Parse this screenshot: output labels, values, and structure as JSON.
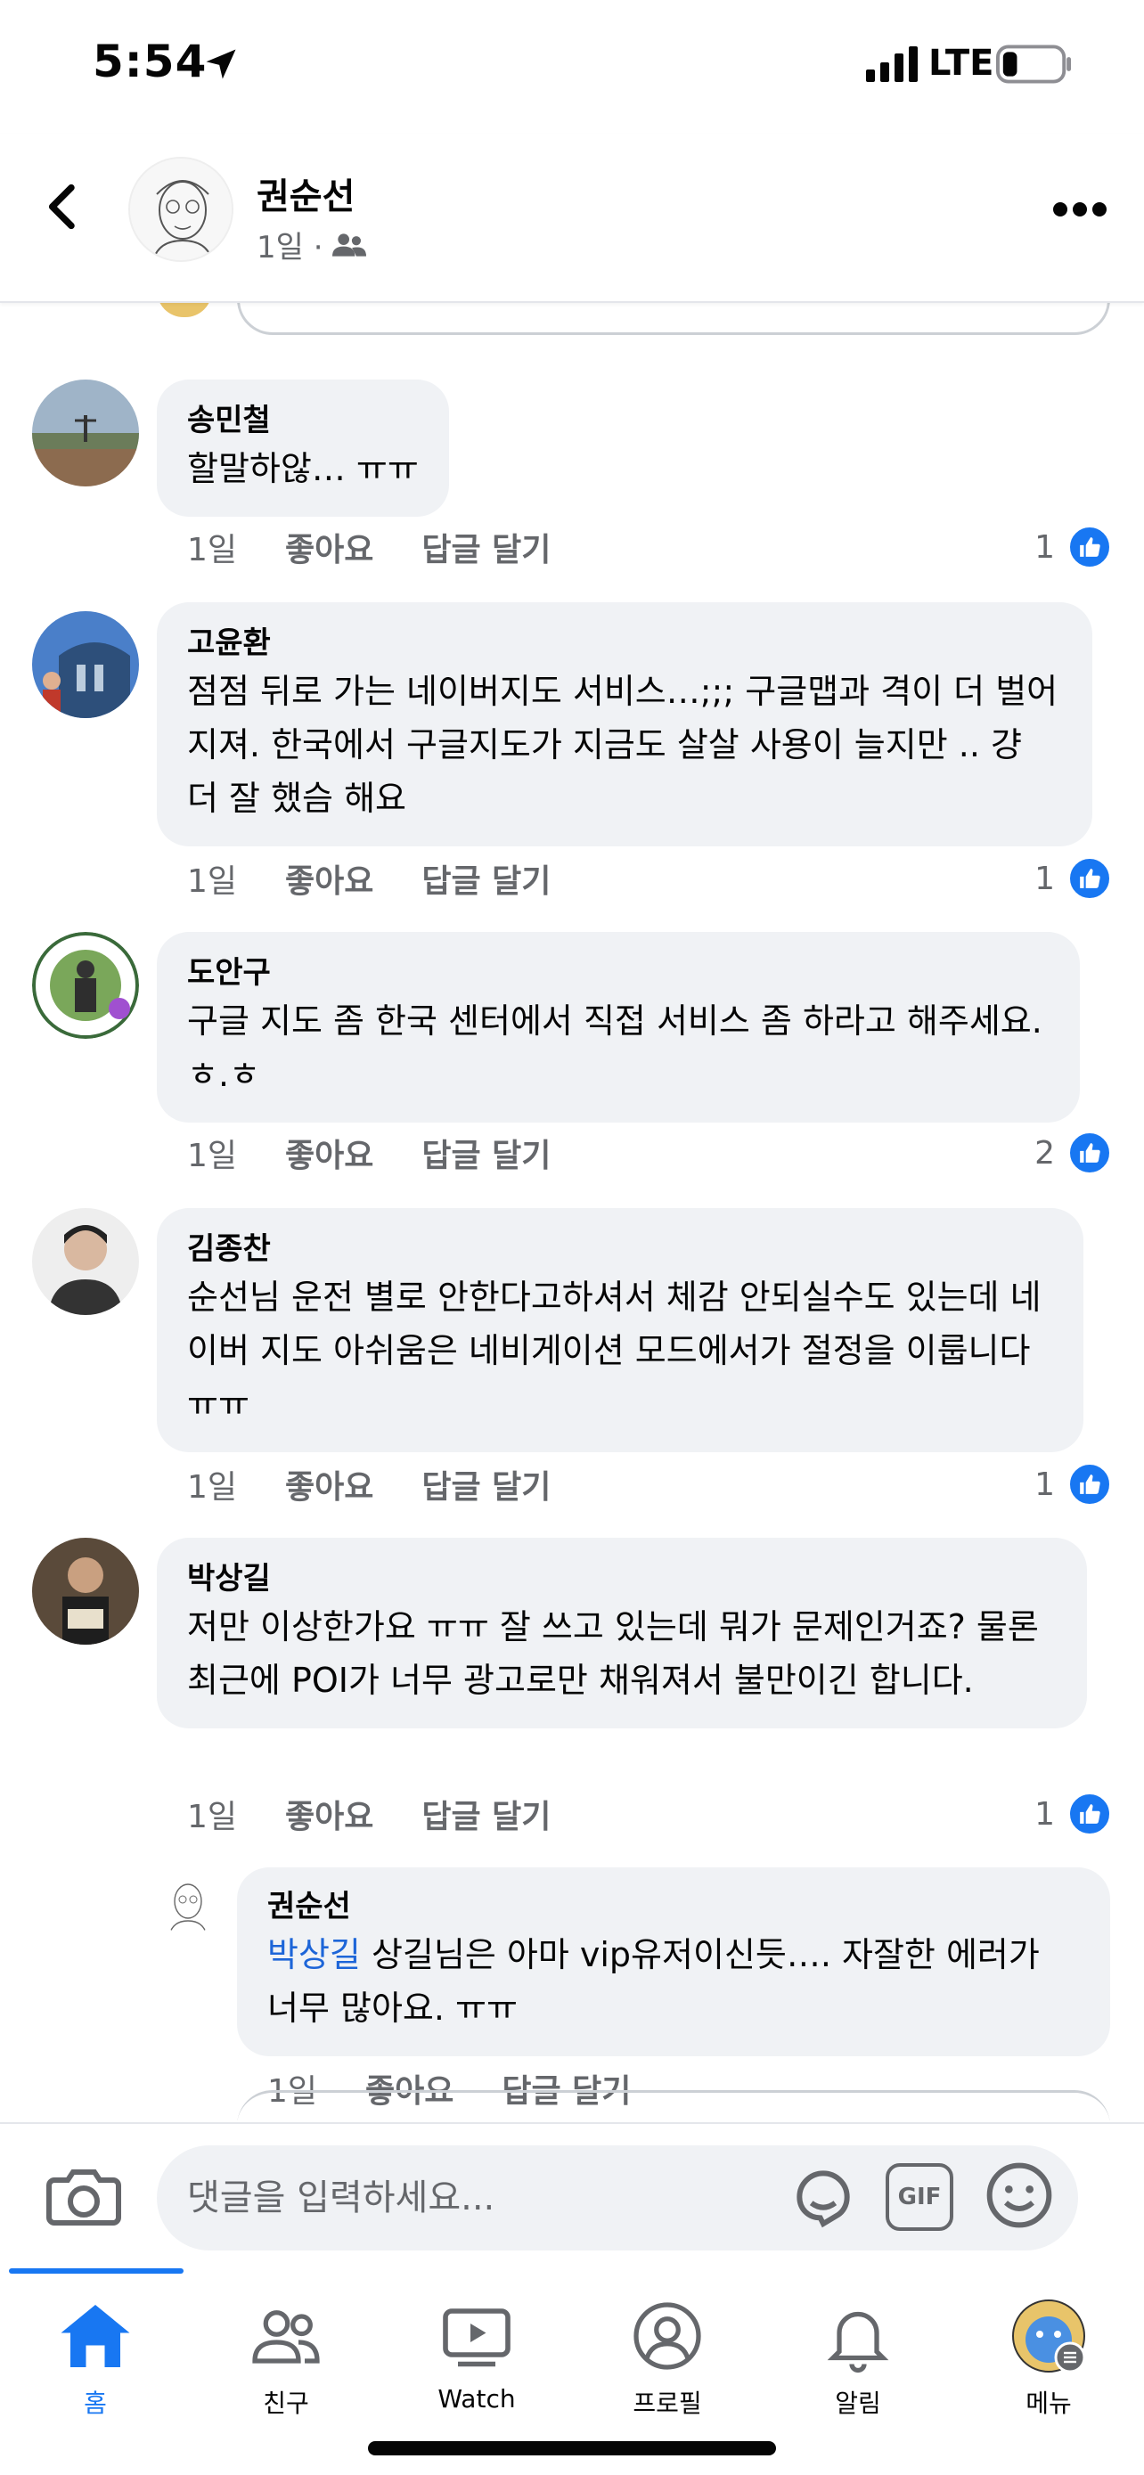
{
  "status_bar": {
    "time": "5:54",
    "network": "LTE"
  },
  "header": {
    "name": "권순선",
    "meta_time": "1일 ·"
  },
  "comments": [
    {
      "author": "송민철",
      "text": "할말하않… ㅠㅠ",
      "time": "1일",
      "like": "좋아요",
      "reply": "답글 달기",
      "likes": "1"
    },
    {
      "author": "고윤환",
      "text": "점점 뒤로 가는 네이버지도 서비스…;;; 구글맵과 격이 더 벌어지져. 한국에서 구글지도가 지금도 살살 사용이 늘지만 .. 걍 더 잘 했슴 해요",
      "time": "1일",
      "like": "좋아요",
      "reply": "답글 달기",
      "likes": "1"
    },
    {
      "author": "도안구",
      "text": "구글 지도 좀 한국 센터에서 직접 서비스 좀 하라고 해주세요. ㅎ.ㅎ",
      "time": "1일",
      "like": "좋아요",
      "reply": "답글 달기",
      "likes": "2"
    },
    {
      "author": "김종찬",
      "text": "순선님 운전 별로 안한다고하셔서 체감 안되실수도 있는데 네이버 지도 아쉬움은 네비게이션 모드에서가 절정을 이룹니다 ㅠㅠ",
      "time": "1일",
      "like": "좋아요",
      "reply": "답글 달기",
      "likes": "1"
    },
    {
      "author": "박상길",
      "text": "저만 이상한가요 ㅠㅠ 잘 쓰고 있는데 뭐가 문제인거죠? 물론 최근에 POI가 너무 광고로만 채워져서 불만이긴 합니다.",
      "time": "1일",
      "like": "좋아요",
      "reply": "답글 달기",
      "likes": "1"
    }
  ],
  "reply": {
    "author": "권순선",
    "mention": "박상길",
    "text": " 상길님은 아마 vip유저이신듯…. 자잘한 에러가 너무 많아요. ㅠㅠ",
    "time": "1일",
    "like": "좋아요",
    "reply": "답글 달기"
  },
  "composer": {
    "placeholder": "댓글을 입력하세요...",
    "gif_label": "GIF"
  },
  "tabs": [
    {
      "label": "홈",
      "icon": "home-icon",
      "active": true
    },
    {
      "label": "친구",
      "icon": "friends-icon"
    },
    {
      "label": "Watch",
      "icon": "watch-icon"
    },
    {
      "label": "프로필",
      "icon": "profile-icon"
    },
    {
      "label": "알림",
      "icon": "bell-icon"
    },
    {
      "label": "메뉴",
      "icon": "menu-icon"
    }
  ],
  "colors": {
    "accent": "#1877f2",
    "bubble": "#f0f2f5",
    "secondary_text": "#65676b",
    "mention": "#1d65d8"
  }
}
